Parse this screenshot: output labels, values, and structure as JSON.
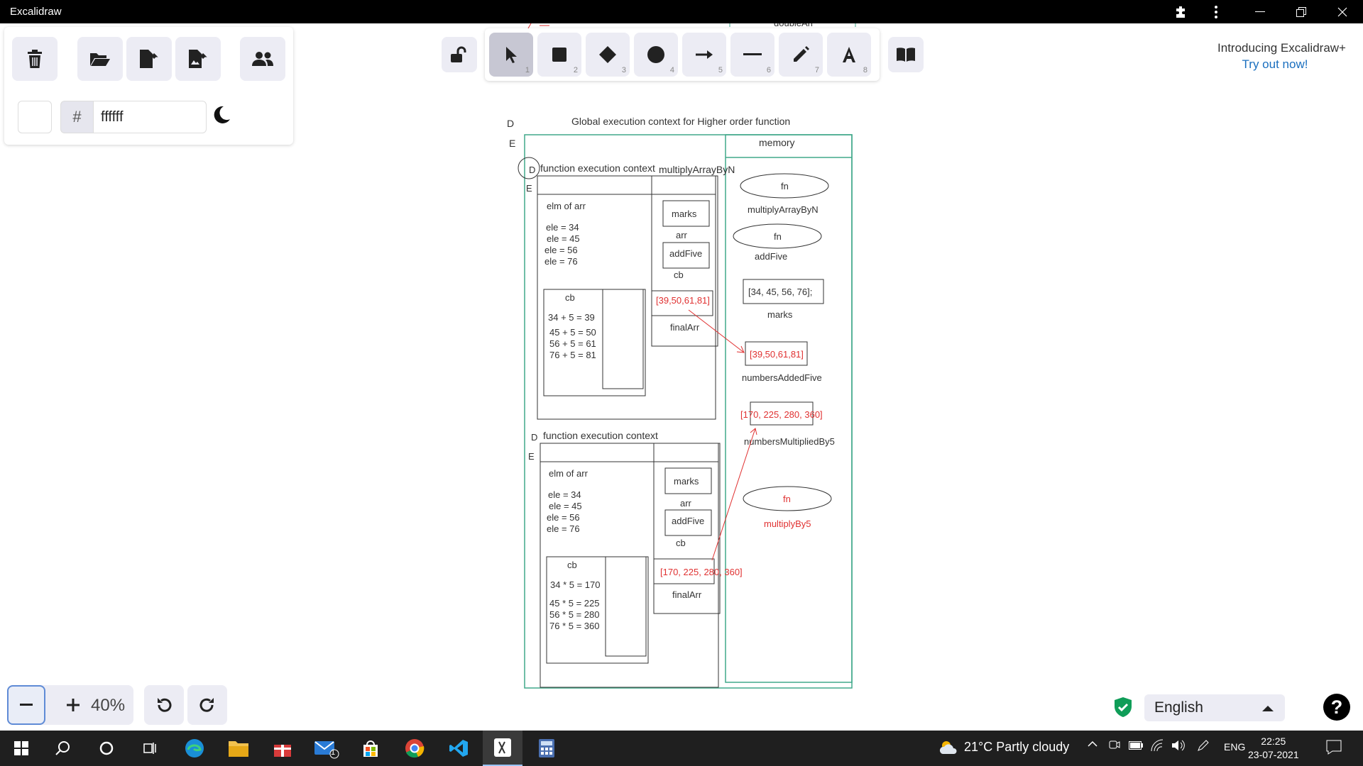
{
  "window": {
    "title": "Excalidraw"
  },
  "menu": {
    "color_hex": "ffffff",
    "hash": "#"
  },
  "toolbar": {
    "nums": [
      "1",
      "2",
      "3",
      "4",
      "5",
      "6",
      "7",
      "8"
    ]
  },
  "promo": {
    "line1": "Introducing Excalidraw+",
    "line2": "Try out now!"
  },
  "zoom": {
    "value": "40%"
  },
  "language": {
    "selected": "English"
  },
  "help": {
    "label": "?"
  },
  "canvas": {
    "top_label": "doubleArr",
    "title": "Global execution context for Higher order function",
    "D": "D",
    "E": "E",
    "memory": "memory",
    "fec1": {
      "title": "function execution context",
      "fn_name": "multiplyArrayByN",
      "elm": "elm of arr",
      "ele": [
        "ele  = 34",
        "ele = 45",
        "ele = 56",
        "ele = 76"
      ],
      "cb": "cb",
      "ops": [
        "34 + 5  = 39",
        "45 + 5 = 50",
        "56 + 5 = 61",
        "76 + 5 = 81"
      ],
      "marks": "marks",
      "arr": "arr",
      "addFive": "addFive",
      "cb2": "cb",
      "result": "[39,50,61,81]",
      "finalArr": "finalArr"
    },
    "fec2": {
      "title": "function execution context",
      "elm": "elm of arr",
      "ele": [
        "ele  = 34",
        "ele = 45",
        "ele = 56",
        "ele = 76"
      ],
      "cb": "cb",
      "ops": [
        "34 * 5   = 170",
        "45 * 5 = 225",
        "56 * 5 = 280",
        "76 * 5 = 360"
      ],
      "marks": "marks",
      "arr": "arr",
      "addFive": "addFive",
      "cb2": "cb",
      "result": "[170, 225, 280, 360]",
      "finalArr": "finalArr"
    },
    "mem": {
      "fn": "fn",
      "multiplyArrayByN": "multiplyArrayByN",
      "addFive": "addFive",
      "marks_val": "[34, 45, 56, 76];",
      "marks": "marks",
      "added_val": "[39,50,61,81]",
      "numbersAddedFive": "numbersAddedFive",
      "mult_val": "[170, 225, 280, 360]",
      "numbersMultipliedBy5": "numbersMultipliedBy5",
      "multiplyBy5": "multiplyBy5"
    }
  },
  "taskbar": {
    "weather": "21°C  Partly cloudy",
    "lang": "ENG",
    "time": "22:25",
    "date": "23-07-2021",
    "mail_badge": "1"
  },
  "colors": {
    "accent": "#0f9d58",
    "red": "#e03131",
    "teal": "#40a88a"
  }
}
